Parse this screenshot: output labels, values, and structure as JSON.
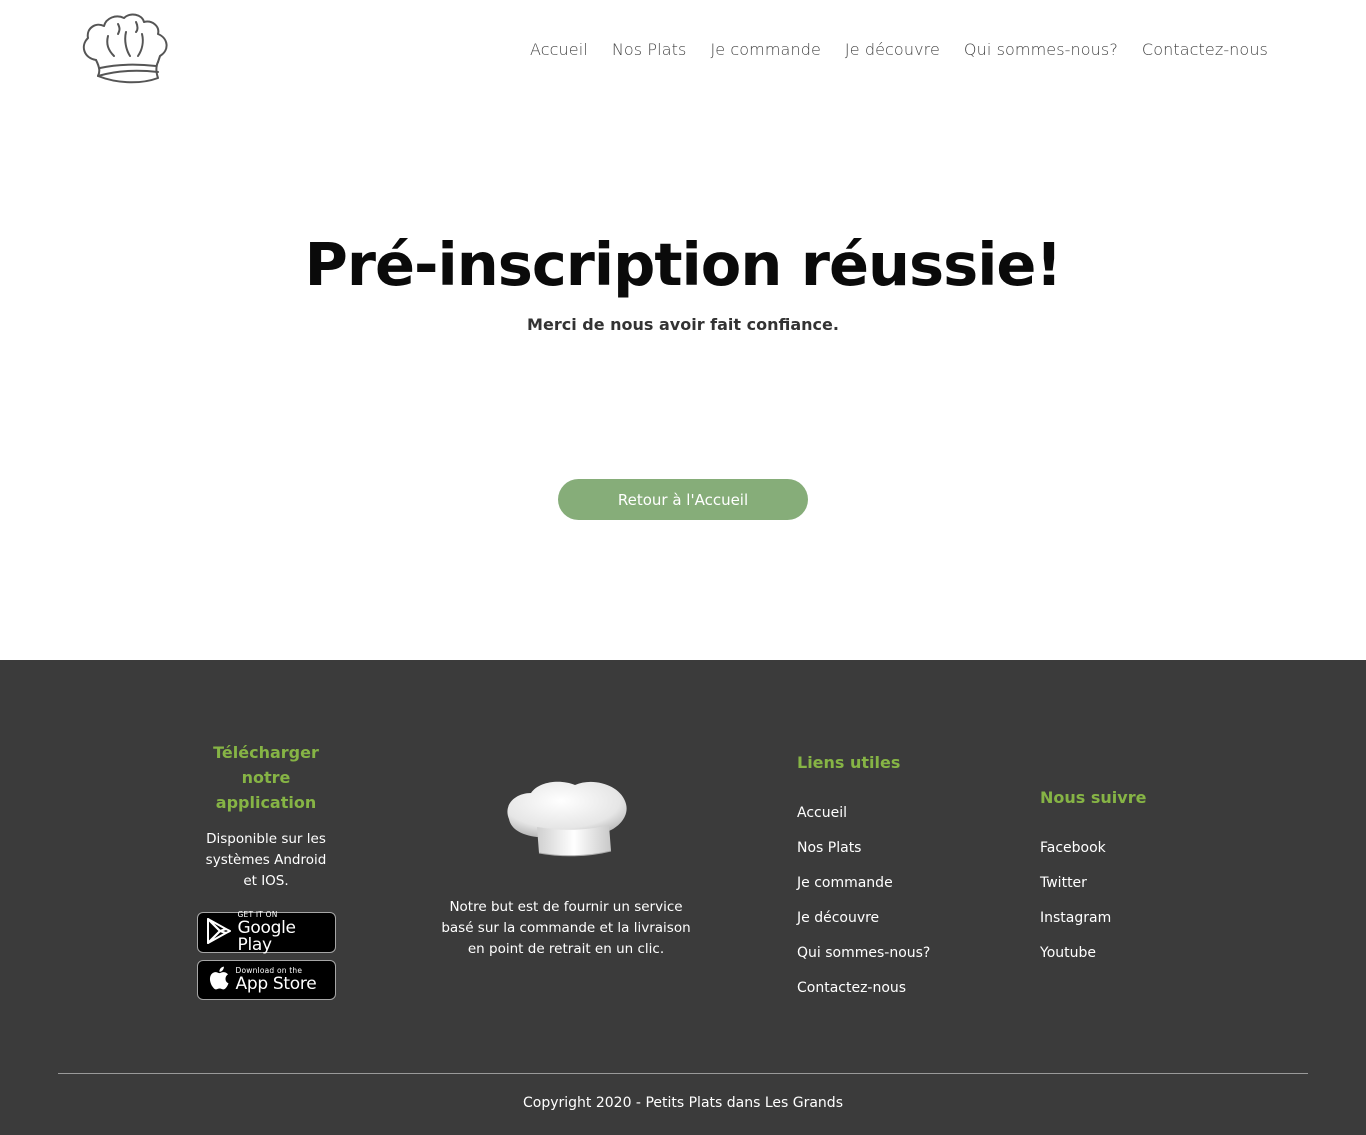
{
  "nav": {
    "items": [
      "Accueil",
      "Nos Plats",
      "Je commande",
      "Je découvre",
      "Qui sommes-nous?",
      "Contactez-nous"
    ]
  },
  "hero": {
    "title": "Pré-inscription réussie!",
    "subtitle": "Merci de nous avoir fait confiance.",
    "button_label": "Retour à l'Accueil"
  },
  "footer": {
    "app": {
      "heading": "Télécharger notre application",
      "description": "Disponible sur les systèmes Android et IOS.",
      "google_play": {
        "small": "GET IT ON",
        "big": "Google Play"
      },
      "app_store": {
        "small": "Download on the",
        "big": "App Store"
      }
    },
    "mission": {
      "text": "Notre but est de fournir un service basé sur la commande et la livraison en point de retrait en un clic."
    },
    "links": {
      "heading": "Liens utiles",
      "items": [
        "Accueil",
        "Nos Plats",
        "Je commande",
        "Je découvre",
        "Qui sommes-nous?",
        "Contactez-nous"
      ]
    },
    "follow": {
      "heading": "Nous suivre",
      "items": [
        "Facebook",
        "Twitter",
        "Instagram",
        "Youtube"
      ]
    },
    "copyright": "Copyright 2020 - Petits Plats dans Les Grands"
  },
  "colors": {
    "accent_green": "#86b445",
    "button_green": "#86ad79",
    "footer_bg": "#3b3b3b"
  },
  "icons": {
    "logo": "chef-hat-outline-icon",
    "footer_image": "chef-hat-icon",
    "google_play": "google-play-icon",
    "app_store": "apple-icon"
  }
}
